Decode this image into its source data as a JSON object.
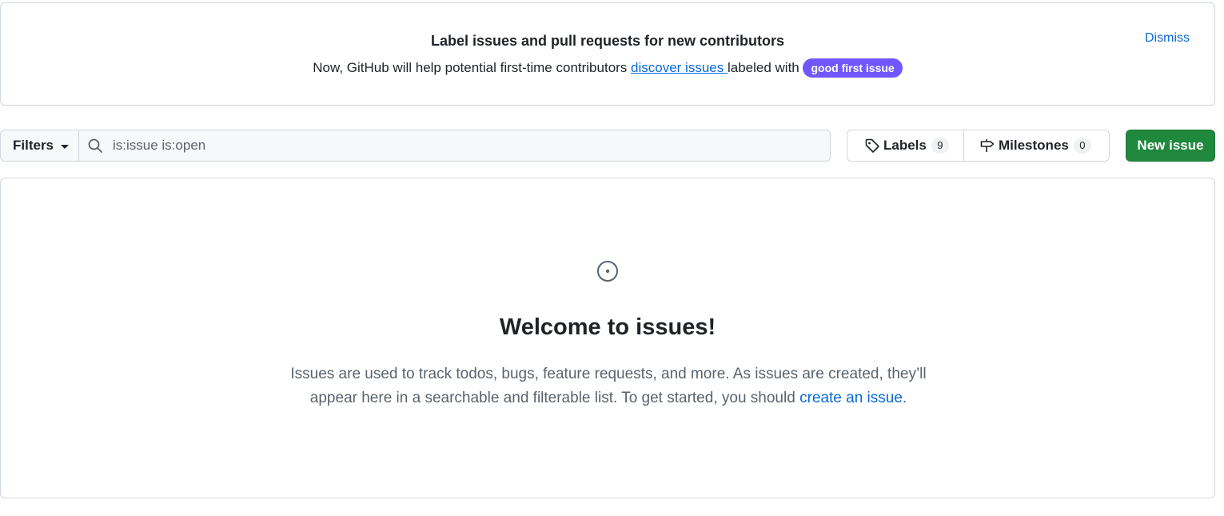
{
  "banner": {
    "title": "Label issues and pull requests for new contributors",
    "text_before": "Now, GitHub will help potential first-time contributors ",
    "link_text": "discover issues ",
    "text_after": "labeled with ",
    "label": "good first issue",
    "label_color": "#7057ff",
    "dismiss": "Dismiss"
  },
  "toolbar": {
    "filters_label": "Filters",
    "search_value": "is:issue is:open",
    "labels": {
      "label": "Labels",
      "count": "9"
    },
    "milestones": {
      "label": "Milestones",
      "count": "0"
    },
    "new_issue_label": "New issue",
    "new_issue_color": "#1f883d"
  },
  "blankslate": {
    "icon": "issue-opened-icon",
    "title": "Welcome to issues!",
    "desc_line1": "Issues are used to track todos, bugs, feature requests, and more. As issues are created, they’ll",
    "desc_line2": "appear here in a searchable and filterable list. To get started, you should ",
    "link_text": "create an issue",
    "period": "."
  }
}
